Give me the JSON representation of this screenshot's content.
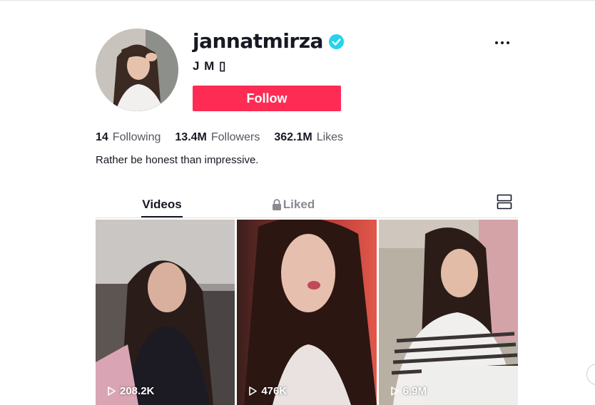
{
  "profile": {
    "username": "jannatmirza",
    "nickname": "J M ▯",
    "follow_label": "Follow",
    "bio": "Rather be honest than impressive.",
    "verified": true
  },
  "stats": [
    {
      "count": "14",
      "label": "Following"
    },
    {
      "count": "13.4M",
      "label": "Followers"
    },
    {
      "count": "362.1M",
      "label": "Likes"
    }
  ],
  "tabs": {
    "videos": "Videos",
    "liked": "Liked"
  },
  "videos": [
    {
      "views": "208.2K"
    },
    {
      "views": "476K"
    },
    {
      "views": "6.9M"
    }
  ],
  "colors": {
    "brand": "#fe2c55",
    "verified": "#20d5ec",
    "text": "#161823",
    "muted": "#8a8b91"
  },
  "icons": {
    "verified": "verified-badge-icon",
    "more": "more-dots-icon",
    "lock": "lock-icon",
    "layout": "layout-toggle-icon",
    "play": "play-icon"
  }
}
